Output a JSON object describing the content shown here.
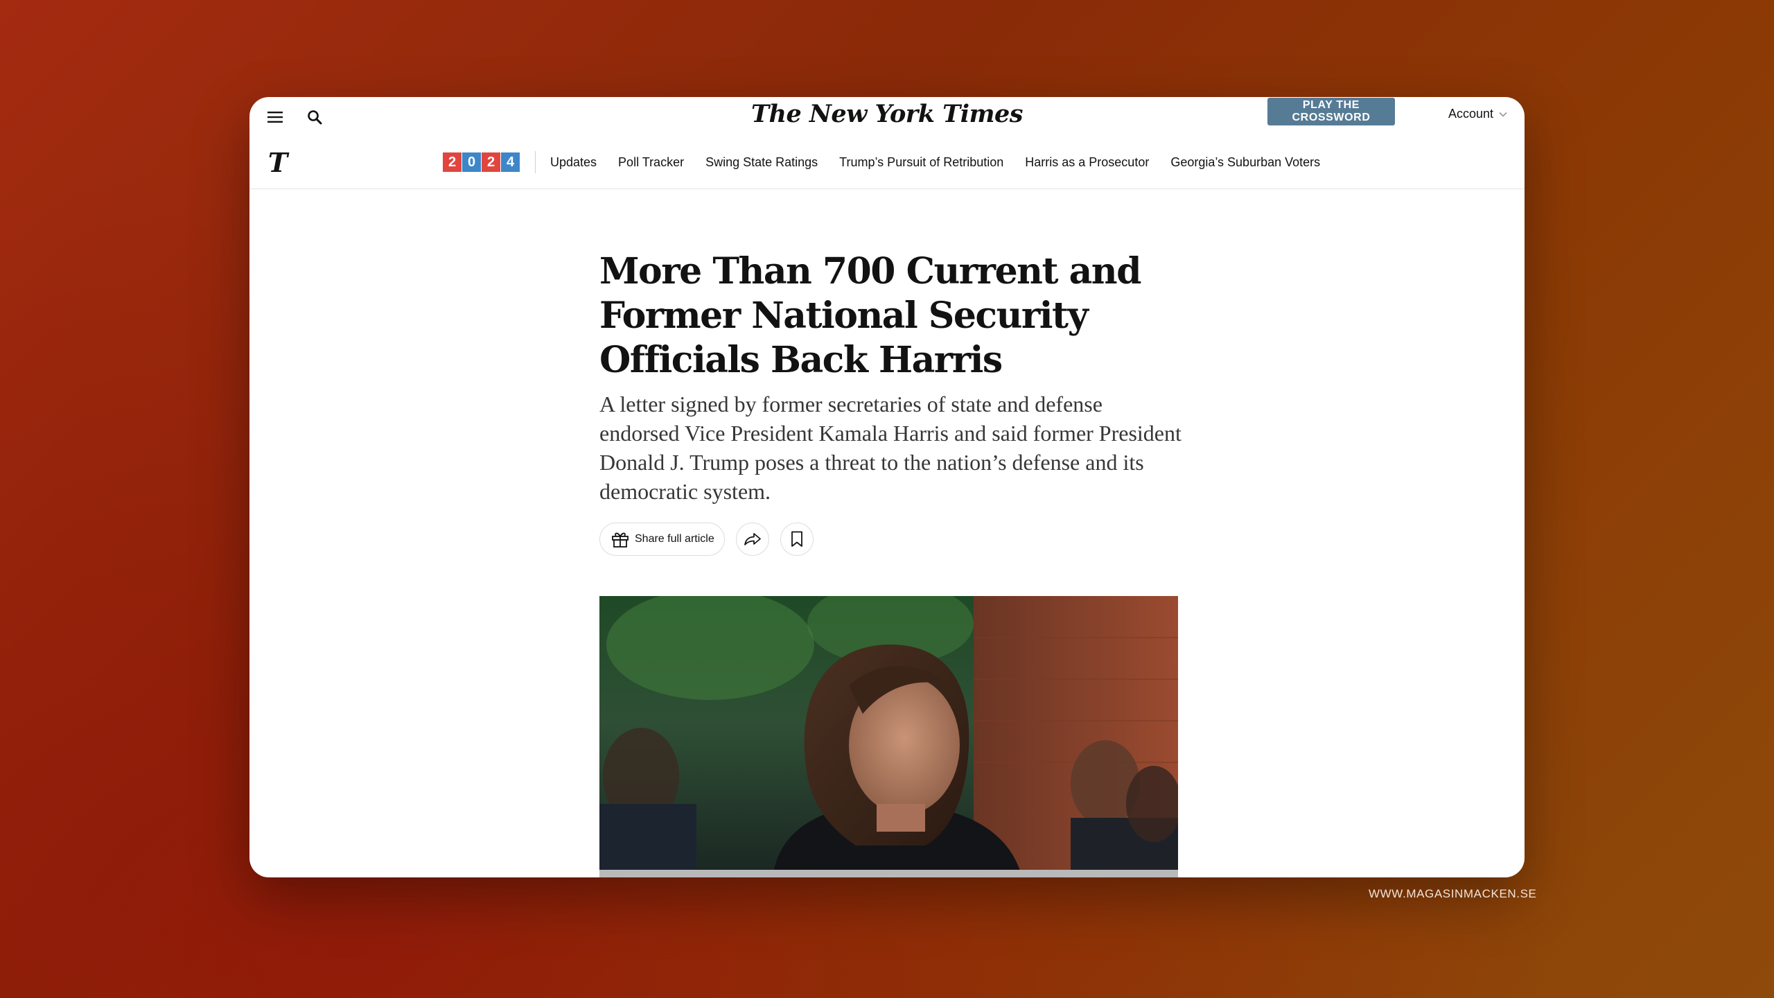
{
  "site": {
    "masthead": "The New York Times",
    "logo_letter": "T"
  },
  "topbar": {
    "crossword_button": "PLAY THE CROSSWORD",
    "account_label": "Account",
    "icons": [
      "menu-icon",
      "search-icon",
      "chevron-down-icon"
    ]
  },
  "nav": {
    "year_digits": [
      "2",
      "0",
      "2",
      "4"
    ],
    "year_colors": [
      "#e0463f",
      "#3d86c8",
      "#e0463f",
      "#3d86c8"
    ],
    "links": [
      "Updates",
      "Poll Tracker",
      "Swing State Ratings",
      "Trump’s Pursuit of Retribution",
      "Harris as a Prosecutor",
      "Georgia’s Suburban Voters"
    ]
  },
  "article": {
    "headline": "More Than 700 Current and Former National Security Officials Back Harris",
    "summary": "A letter signed by former secretaries of state and defense endorsed Vice President Kamala Harris and said former President Donald J. Trump poses a threat to the nation’s defense and its democratic system.",
    "share_label": "Share full article",
    "icons": [
      "gift-icon",
      "share-arrow-icon",
      "bookmark-icon"
    ]
  },
  "colors": {
    "crossword_button": "#567b95",
    "text": "#121212",
    "summary_text": "#363636"
  },
  "footer": {
    "watermark": "WWW.MAGASINMACKEN.SE"
  }
}
